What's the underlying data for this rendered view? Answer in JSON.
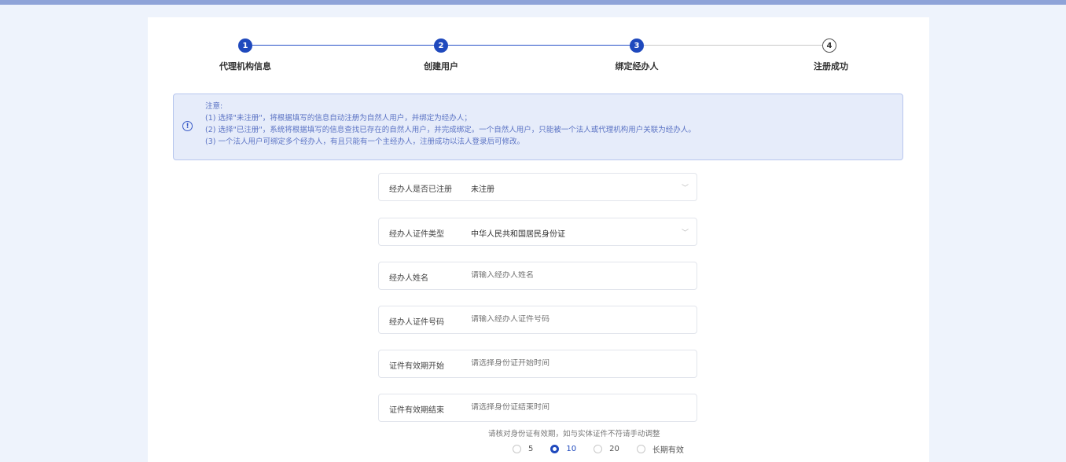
{
  "steps": [
    {
      "number": "1",
      "label": "代理机构信息",
      "status": "done"
    },
    {
      "number": "2",
      "label": "创建用户",
      "status": "done"
    },
    {
      "number": "3",
      "label": "绑定经办人",
      "status": "active"
    },
    {
      "number": "4",
      "label": "注册成功",
      "status": "pending"
    }
  ],
  "notice": {
    "title": "注意:",
    "lines": [
      "(1) 选择\"未注册\"，将根据填写的信息自动注册为自然人用户，并绑定为经办人；",
      "(2) 选择\"已注册\"，系统将根据填写的信息查找已存在的自然人用户，并完成绑定。一个自然人用户，只能被一个法人或代理机构用户关联为经办人。",
      "(3) 一个法人用户可绑定多个经办人，有且只能有一个主经办人，注册成功以法人登录后可修改。"
    ]
  },
  "form": {
    "registered": {
      "label": "经办人是否已注册",
      "value": "未注册"
    },
    "id_type": {
      "label": "经办人证件类型",
      "value": "中华人民共和国居民身份证"
    },
    "name": {
      "label": "经办人姓名",
      "placeholder": "请输入经办人姓名"
    },
    "id_number": {
      "label": "经办人证件号码",
      "placeholder": "请输入经办人证件号码"
    },
    "valid_start": {
      "label": "证件有效期开始",
      "placeholder": "请选择身份证开始时间"
    },
    "valid_end": {
      "label": "证件有效期结束",
      "placeholder": "请选择身份证结束时间"
    },
    "hint": "请核对身份证有效期，如与实体证件不符请手动调整",
    "validity_options": [
      {
        "label": "5",
        "selected": false
      },
      {
        "label": "10",
        "selected": true
      },
      {
        "label": "20",
        "selected": false
      },
      {
        "label": "长期有效",
        "selected": false
      }
    ]
  },
  "colors": {
    "primary": "#1f49bd",
    "notice_bg": "#e6ecfa",
    "notice_text": "#5b73c4"
  }
}
